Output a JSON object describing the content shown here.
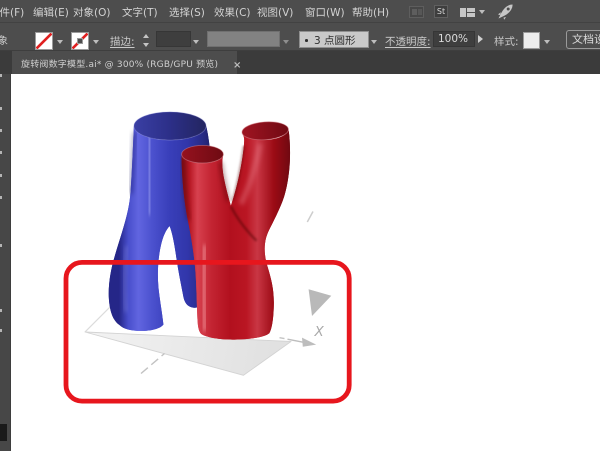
{
  "menu_bar": {
    "items": [
      {
        "label": "文件(F)"
      },
      {
        "label": "编辑(E)"
      },
      {
        "label": "对象(O)"
      },
      {
        "label": "文字(T)"
      },
      {
        "label": "选择(S)"
      },
      {
        "label": "效果(C)"
      },
      {
        "label": "视图(V)"
      },
      {
        "label": "窗口(W)"
      },
      {
        "label": "帮助(H)"
      }
    ],
    "icons": {
      "arrange_documents": "arrange-documents-icon",
      "stock_label": "St",
      "workspace_switcher": "workspace-switcher-icon",
      "gpu_performance": "gpu-rocket-icon"
    }
  },
  "control_bar": {
    "selection_label": "对象",
    "fill_swatch": "none",
    "stroke_swatch": "none",
    "stroke_label": "描边:",
    "stroke_weight_value": "",
    "brush_label": "3 点圆形",
    "opacity_label": "不透明度:",
    "opacity_value": "100%",
    "style_label": "样式:",
    "document_setup_label": "文档设置"
  },
  "document_tab": {
    "title": "旋转阀数字模型.ai* @ 300% (RGB/GPU 预览)",
    "close": "×"
  },
  "canvas": {
    "zoom": "300%",
    "axis_x_label": "X",
    "annotation": {
      "shape": "rounded-rectangle",
      "color": "#E9151C"
    },
    "artwork": {
      "description": "two interlocking 3D Y-shaped tubes on a ground plane",
      "blue_tube_color": "#3A3EB5",
      "red_tube_color": "#C01020",
      "floor_color": "#ECECEC"
    }
  }
}
